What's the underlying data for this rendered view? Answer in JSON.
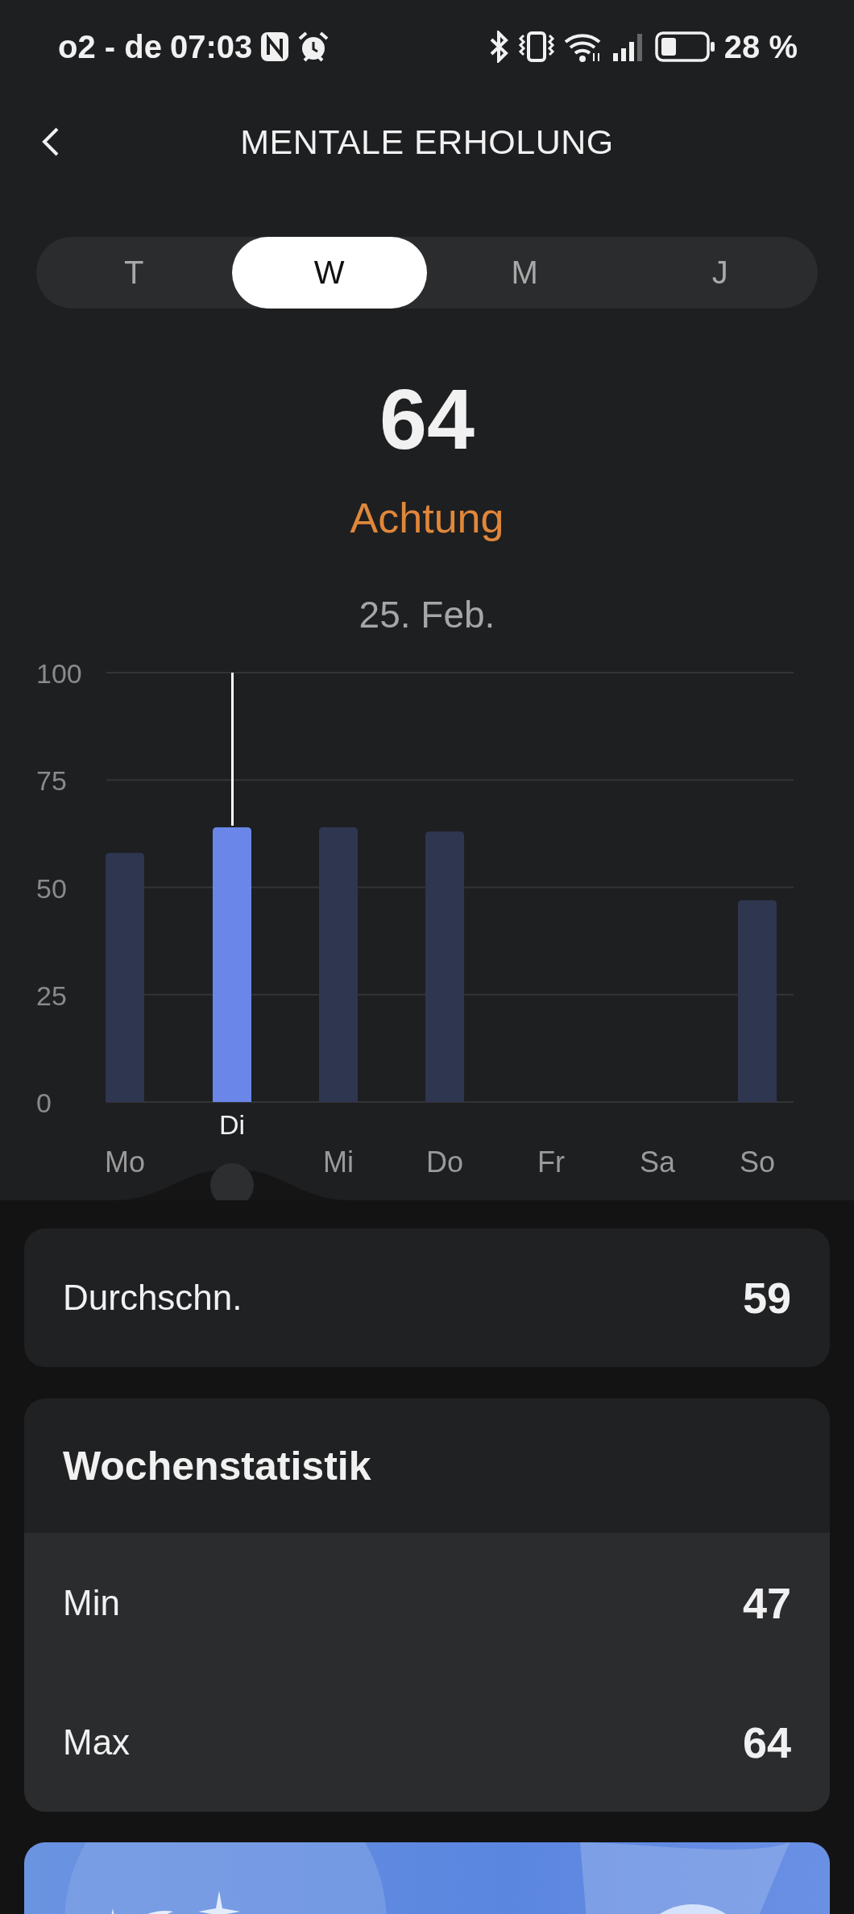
{
  "status_bar": {
    "carrier": "o2 - de",
    "time": "07:03",
    "battery": "28 %"
  },
  "header": {
    "title": "MENTALE ERHOLUNG"
  },
  "tabs": [
    {
      "label": "T",
      "selected": false
    },
    {
      "label": "W",
      "selected": true
    },
    {
      "label": "M",
      "selected": false
    },
    {
      "label": "J",
      "selected": false
    }
  ],
  "score": {
    "value": "64",
    "status": "Achtung",
    "date": "25. Feb."
  },
  "chart": {
    "chart_data": {
      "type": "bar",
      "categories": [
        "Mo",
        "Di",
        "Mi",
        "Do",
        "Fr",
        "Sa",
        "So"
      ],
      "series": [
        {
          "color": "#2f3650",
          "values": [
            58,
            null,
            64,
            63,
            null,
            null,
            47
          ]
        },
        {
          "color": "#6a86e8",
          "values": [
            null,
            64,
            null,
            null,
            null,
            null,
            null
          ]
        }
      ],
      "ylim": [
        0,
        100
      ],
      "yticks": [
        0,
        25,
        50,
        75,
        100
      ],
      "grid": true
    },
    "days": [
      {
        "selected": false
      },
      {
        "selected": true
      },
      {
        "selected": false
      },
      {
        "selected": false
      },
      {
        "selected": false
      },
      {
        "selected": false
      },
      {
        "selected": false
      }
    ]
  },
  "average": {
    "label": "Durchschn.",
    "value": "59"
  },
  "weekly_stats": {
    "title": "Wochenstatistik",
    "rows": [
      {
        "label": "Min",
        "value": "47"
      },
      {
        "label": "Max",
        "value": "64"
      }
    ]
  }
}
